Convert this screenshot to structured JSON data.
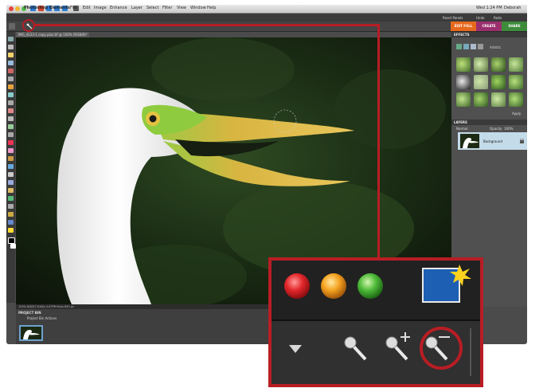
{
  "app": {
    "name": "Photoshop Elements",
    "menus": [
      "File",
      "Edit",
      "Image",
      "Enhance",
      "Layer",
      "Select",
      "Filter",
      "View",
      "Window",
      "Help"
    ],
    "clock": "Wed 1:24 PM",
    "user": "Deborah"
  },
  "toolbar": {
    "reset_panels": "Reset Panels",
    "undo": "Undo",
    "redo": "Redo"
  },
  "mode_tabs": [
    {
      "label": "EDIT FULL",
      "color": "#e7691d"
    },
    {
      "label": "CREATE",
      "color": "#9b2f6e"
    },
    {
      "label": "SHARE",
      "color": "#3d8c3b"
    }
  ],
  "document": {
    "tab_title": "IMG_4123-1 copy plus.tif @ 100% (RGB/8)*",
    "status": "100%   8/8/07 8:00a 4:47PM ticks 630 px"
  },
  "panels": {
    "effects_title": "EFFECTS",
    "effects_filter": "Artistic",
    "effects_apply": "Apply",
    "layers_title": "LAYERS",
    "layers_blend": "Normal",
    "layers_opacity_label": "Opacity",
    "layers_opacity": "100%",
    "layer_name": "Background"
  },
  "project_bin": {
    "title": "PROJECT BIN",
    "dropdown": "Project Bin Actions"
  },
  "colors": {
    "accent_red": "#b81d24",
    "layer_highlight": "#c4dbe9"
  },
  "icons": [
    "close-icon",
    "minimize-icon",
    "zoom-icon",
    "app-icon",
    "lasso-icon",
    "magic-selection-brush-icon",
    "add-to-selection-icon",
    "subtract-from-selection-icon",
    "new-feature-icon",
    "dropdown-arrow-icon"
  ]
}
